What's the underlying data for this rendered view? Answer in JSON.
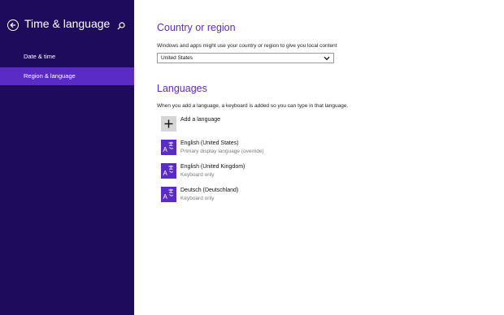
{
  "colors": {
    "sidebar_bg": "#1e0b5c",
    "accent": "#5b2bc6",
    "selected_item_bg": "#5b2bc6"
  },
  "sidebar": {
    "back_icon": "back-arrow-icon",
    "title": "Time & language",
    "search_icon": "search-icon",
    "items": [
      {
        "label": "Date & time",
        "selected": false
      },
      {
        "label": "Region & language",
        "selected": true
      }
    ]
  },
  "country": {
    "title": "Country or region",
    "description": "Windows and apps might use your country or region to give you local content",
    "dropdown_value": "United States"
  },
  "languages": {
    "title": "Languages",
    "description": "When you add a language, a keyboard is added so you can type in that language.",
    "add_label": "Add a language",
    "items": [
      {
        "name": "English (United States)",
        "detail": "Primary display language (override)"
      },
      {
        "name": "English (United Kingdom)",
        "detail": "Keyboard only"
      },
      {
        "name": "Deutsch (Deutschland)",
        "detail": "Keyboard only"
      }
    ]
  }
}
